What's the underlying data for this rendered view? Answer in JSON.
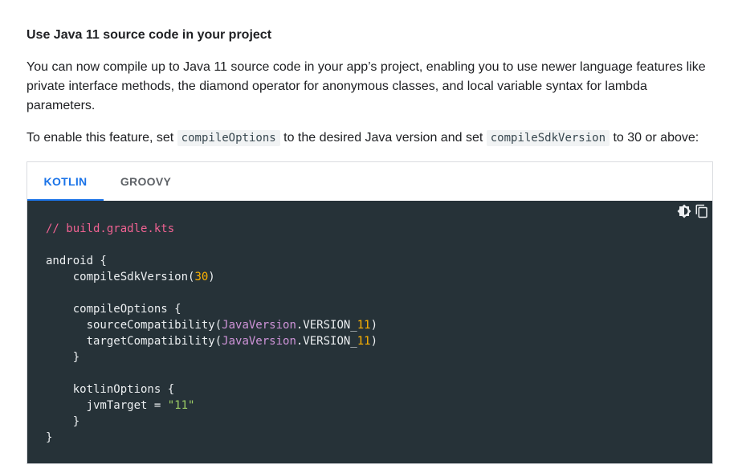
{
  "section": {
    "heading": "Use Java 11 source code in your project",
    "paragraph1": "You can now compile up to Java 11 source code in your app’s project, enabling you to use newer language features like private interface methods, the diamond operator for anonymous classes, and local variable syntax for lambda parameters.",
    "paragraph2": {
      "part1": "To enable this feature, set ",
      "code1": "compileOptions",
      "part2": " to the desired Java version and set ",
      "code2": "compileSdkVersion",
      "part3": " to 30 or above:"
    }
  },
  "code_card": {
    "tabs": [
      {
        "label": "KOTLIN",
        "selected": true
      },
      {
        "label": "GROOVY",
        "selected": false
      }
    ],
    "actions": {
      "theme_icon": "brightness-icon",
      "copy_icon": "copy-icon"
    },
    "code": {
      "comment": "// build.gradle.kts",
      "l_android": "android {",
      "l_sdk_open": "    compileSdkVersion(",
      "l_sdk_num": "30",
      "l_sdk_close": ")",
      "l_co_open": "    compileOptions {",
      "l_src_open": "      sourceCompatibility(",
      "l_src_type": "JavaVersion",
      "l_src_dot": ".VERSION_",
      "l_src_num": "11",
      "l_src_close": ")",
      "l_tgt_open": "      targetCompatibility(",
      "l_tgt_type": "JavaVersion",
      "l_tgt_dot": ".VERSION_",
      "l_tgt_num": "11",
      "l_tgt_close": ")",
      "l_co_close": "    }",
      "l_ko_open": "    kotlinOptions {",
      "l_jvm_key": "      jvmTarget = ",
      "l_jvm_val": "\"11\"",
      "l_ko_close": "    }",
      "l_close": "}"
    }
  },
  "colors": {
    "accent": "#1a73e8",
    "code_background": "#263238",
    "comment": "#f06292",
    "number": "#ffb300",
    "type": "#ce93d8",
    "string": "#9ccc65"
  }
}
